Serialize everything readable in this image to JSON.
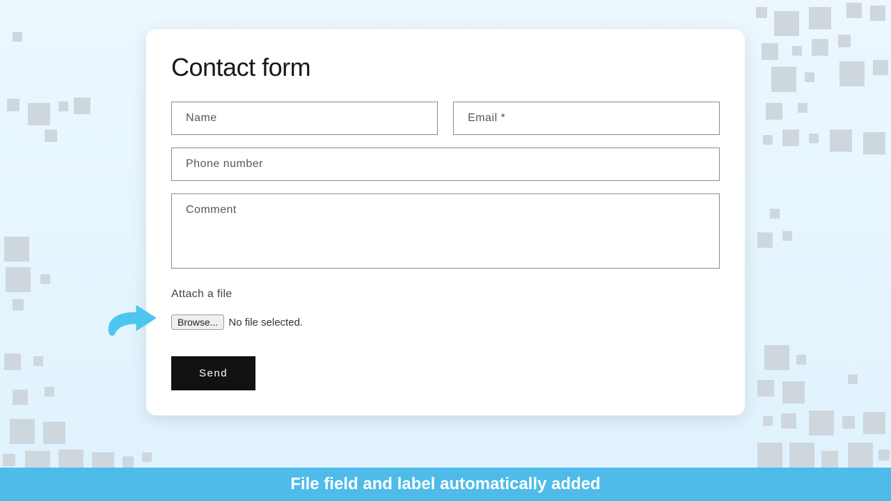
{
  "form": {
    "title": "Contact form",
    "fields": {
      "name_placeholder": "Name",
      "email_placeholder": "Email *",
      "phone_placeholder": "Phone number",
      "comment_placeholder": "Comment"
    },
    "attach": {
      "label": "Attach a file",
      "browse_button": "Browse...",
      "status": "No file selected."
    },
    "submit_label": "Send"
  },
  "banner": {
    "text": "File field and label automatically added"
  }
}
